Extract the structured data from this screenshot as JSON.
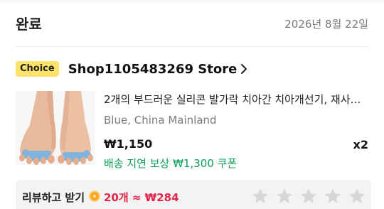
{
  "order": {
    "status": "완료",
    "date": "2026년 8월 22일"
  },
  "store": {
    "badge": "Choice",
    "name": "Shop1105483269 Store"
  },
  "product": {
    "title": "2개의 부드러운 실리콘 발가락 치아간 치아개선기, 재사…",
    "variant": "Blue, China Mainland",
    "price": "₩1,150",
    "quantity": "x2",
    "coupon": "배송 지연 보상 ₩1,300 쿠폰"
  },
  "review": {
    "label": "리뷰하고 받기",
    "reward": "20개 ≈ ₩284",
    "star_count": 5
  },
  "colors": {
    "badge": "#fde36a",
    "coupon_green": "#0b9f5a",
    "reward_red": "#e0264b",
    "star_gray": "#d6d6d6"
  }
}
